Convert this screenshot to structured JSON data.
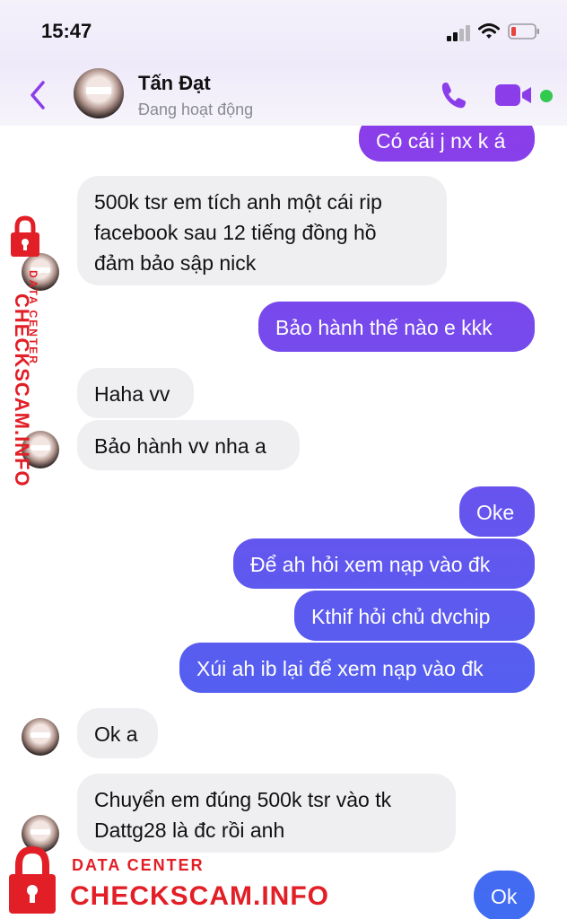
{
  "status_bar": {
    "time": "15:47"
  },
  "contact": {
    "name": "Tấn Đạt",
    "status": "Đang hoạt động"
  },
  "messages": [
    {
      "side": "out",
      "text": "Có cái j nx k á"
    },
    {
      "side": "in",
      "lines": [
        "500k tsr em tích anh một cái rip",
        "facebook sau 12 tiếng đồng hồ",
        "đảm bảo sập nick"
      ]
    },
    {
      "side": "out",
      "text": "Bảo hành thế nào e kkk"
    },
    {
      "side": "in",
      "text": "Haha vv"
    },
    {
      "side": "in",
      "text": "Bảo hành vv nha a"
    },
    {
      "side": "out",
      "text": "Oke"
    },
    {
      "side": "out",
      "text": "Để ah hỏi xem nạp vào đk"
    },
    {
      "side": "out",
      "text": "Kthif hỏi chủ dvchip"
    },
    {
      "side": "out",
      "text": "Xúi ah ib lại để xem nạp vào đk"
    },
    {
      "side": "in",
      "text": "Ok a"
    },
    {
      "side": "in",
      "lines": [
        "Chuyển em đúng 500k tsr vào tk",
        "Dattg28 là đc rồi anh"
      ]
    },
    {
      "side": "out",
      "text": "Ok"
    }
  ],
  "watermark": {
    "small": "DATA CENTER",
    "big": "CHECKSCAM.INFO"
  },
  "colors": {
    "accent": "#8b3dea",
    "outgoing_top": "#8b3dea",
    "outgoing_bottom": "#3f6df2",
    "incoming": "#efeff2",
    "online": "#31c94e",
    "watermark": "#e21e26"
  }
}
